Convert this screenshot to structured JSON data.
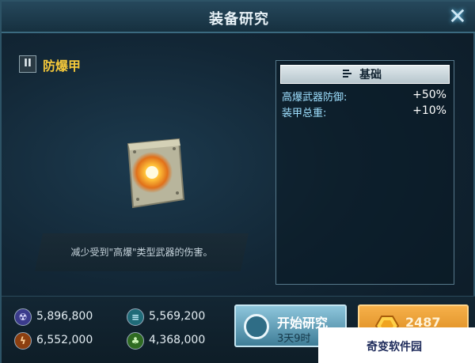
{
  "window": {
    "title": "装备研究"
  },
  "item": {
    "rank": "II",
    "name": "防爆甲",
    "description": "减少受到\"高爆\"类型武器的伤害。"
  },
  "stats": {
    "header": "基础",
    "rows": [
      {
        "label": "高爆武器防御:",
        "value": "+50%"
      },
      {
        "label": "装甲总重:",
        "value": "+10%"
      }
    ]
  },
  "resources": [
    {
      "icon": "radiation-icon",
      "value": "5,896,800",
      "color": "#6a6ad8"
    },
    {
      "icon": "layers-icon",
      "value": "5,569,200",
      "color": "#3ea6b6"
    },
    {
      "icon": "energy-icon",
      "value": "6,552,000",
      "color": "#e07a24"
    },
    {
      "icon": "crystal-icon",
      "value": "4,368,000",
      "color": "#5fb04a"
    }
  ],
  "actions": {
    "research_label": "开始研究",
    "research_time": "3天9时",
    "instant_cost": "2487"
  },
  "watermark": "奇变软件园",
  "colors": {
    "accent_gold": "#f4c83a",
    "stat_label": "#9fe0ff"
  }
}
